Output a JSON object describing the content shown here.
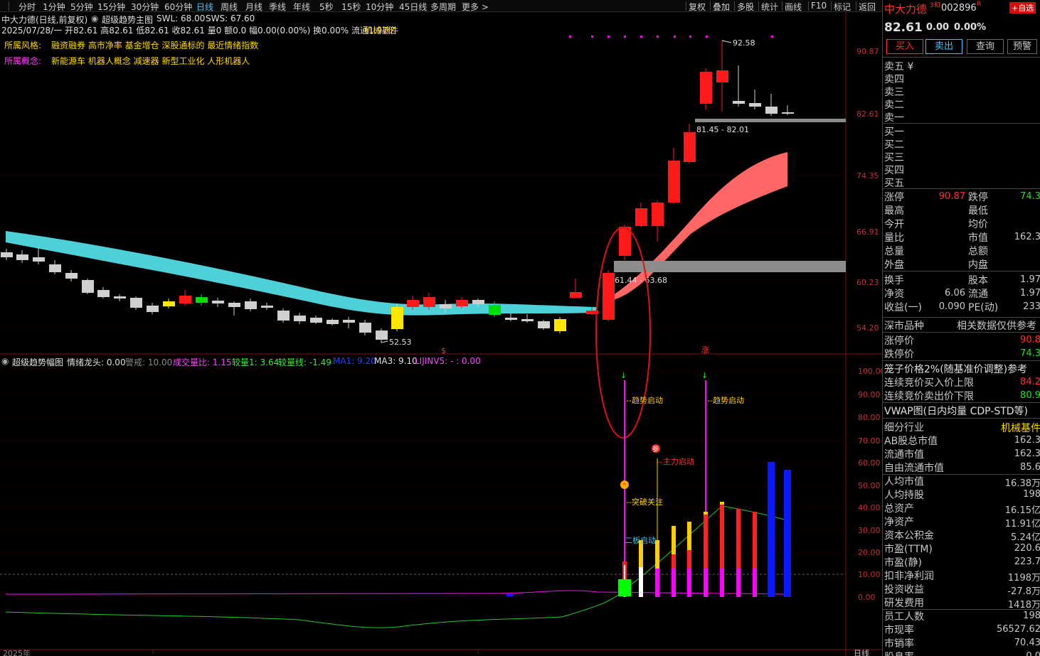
{
  "toolbar": {
    "periods": [
      "分时",
      "1分钟",
      "5分钟",
      "15分钟",
      "30分钟",
      "60分钟",
      "日线",
      "周线",
      "月线",
      "季线",
      "年线",
      "5秒",
      "15秒",
      "10分钟",
      "45日线",
      "多周期",
      "更多 >"
    ],
    "active_period": "日线",
    "right_items": [
      "复权",
      "叠加",
      "多股",
      "统计",
      "画线",
      "F10",
      "标记",
      "返回"
    ]
  },
  "header": {
    "title": "中大力德(日线,前复权)",
    "indicator": "超级趋势主图",
    "swl": "SWL: 68.00",
    "sws": "SWS: 67.60",
    "quote_line": "2025/07/28/一 开82.61 高82.61 低82.61 收82.61 量0 额0.0 幅0.00(0.00%) 换0.00% 流通1.97亿",
    "industry": "机械基件",
    "style_label": "所属风格:",
    "style_value": "融资融券 高市净率 基金增仓 深股通标的 最近情绪指数",
    "concept_label": "所属概念:",
    "concept_value": "新能源车 机器人概念 减速器 新型工业化 人形机器人"
  },
  "main_chart": {
    "price_axis": [
      "90.87",
      "82.61",
      "74.35",
      "66.91",
      "60.23",
      "54.20"
    ],
    "high_label": "92.58",
    "low_label": "52.53",
    "zone_upper": "81.45 - 82.01",
    "zone_lower": "61.44 - 63.68",
    "marker_s": "$",
    "marker_zhang": "涨"
  },
  "sub_chart": {
    "title": "超级趋势幅图",
    "qxlt": "情绪龙头: 0.00",
    "jingjie": "警戒: 10.00",
    "cjlb": "成交量比: 1.15",
    "jl1": "较量1: 3.64",
    "jlx": "较量线: -1.49",
    "ma1": "MA1: 9.20",
    "ma3": "MA3: 9.10",
    "lijinv5": "LIJINV5: - : 0.00",
    "axis": [
      "100.00",
      "90.00",
      "80.00",
      "70.00",
      "60.00",
      "50.00",
      "40.00",
      "30.00",
      "20.00",
      "10.00",
      "0.00"
    ],
    "annotations": {
      "trend1": "--趋势启动",
      "trend2": "--趋势启动",
      "main_force": "--主力启动",
      "breakout": "--突破关注",
      "board2": "二板启动",
      "can_mark": "参"
    }
  },
  "bottom_axis": {
    "left_label": "2025年",
    "right_label": "日线"
  },
  "right_panel": {
    "name": "中大力德",
    "sup": "3和",
    "code": "002896",
    "code_suffix": "R",
    "add_btn": "+自选",
    "price": "82.61",
    "change": "0.00",
    "change_pct": "0.00%",
    "buttons": [
      "买入",
      "卖出",
      "查询",
      "预警"
    ],
    "sell": [
      "卖五 ¥",
      "卖四",
      "卖三",
      "卖二",
      "卖一"
    ],
    "buy": [
      "买一",
      "买二",
      "买三",
      "买四",
      "买五"
    ],
    "stats_left": [
      {
        "k": "涨停",
        "v": "90.87"
      },
      {
        "k": "最高",
        "v": ""
      },
      {
        "k": "今开",
        "v": ""
      },
      {
        "k": "量比",
        "v": ""
      },
      {
        "k": "总量",
        "v": ""
      },
      {
        "k": "外盘",
        "v": ""
      }
    ],
    "stats_right": [
      {
        "k": "跌停",
        "v": "74.3"
      },
      {
        "k": "最低",
        "v": ""
      },
      {
        "k": "均价",
        "v": ""
      },
      {
        "k": "市值",
        "v": "162.3"
      },
      {
        "k": "总额",
        "v": ""
      },
      {
        "k": "内盘",
        "v": ""
      }
    ],
    "fin_left": [
      {
        "k": "换手",
        "v": ""
      },
      {
        "k": "净资",
        "v": "6.06"
      },
      {
        "k": "收益(一)",
        "v": "0.090"
      }
    ],
    "fin_right": [
      {
        "k": "股本",
        "v": "1.97"
      },
      {
        "k": "流通",
        "v": "1.97"
      },
      {
        "k": "PE(动)",
        "v": "233"
      }
    ],
    "market_label": "深市品种",
    "market_note": "相关数据仅供参考",
    "limit_up_label": "涨停价",
    "limit_up_val": "90.8",
    "limit_down_label": "跌停价",
    "limit_down_val": "74.3",
    "cage_label": "笼子价格2%(随基准价调整)参考",
    "bid_limit_label": "连续竞价买入价上限",
    "bid_limit_val": "84.2",
    "ask_limit_label": "连续竞价卖出价下限",
    "ask_limit_val": "80.9",
    "vwap_label": "VWAP图(日内均量 CDP-STD等)",
    "industry_label": "细分行业",
    "industry_val": "机械基件",
    "details": [
      {
        "k": "AB股总市值",
        "v": "162.3"
      },
      {
        "k": "流通市值",
        "v": "162.3"
      },
      {
        "k": "自由流通市值",
        "v": "85.6"
      },
      {
        "k": "人均市值",
        "v": "16.38万"
      },
      {
        "k": "人均持股",
        "v": "198"
      },
      {
        "k": "总资产",
        "v": "16.15亿"
      },
      {
        "k": "净资产",
        "v": "11.91亿"
      },
      {
        "k": "资本公积金",
        "v": "5.24亿"
      },
      {
        "k": "市盈(TTM)",
        "v": "220.6"
      },
      {
        "k": "市盈(静)",
        "v": "223.7"
      },
      {
        "k": "扣非净利润",
        "v": "1198万"
      },
      {
        "k": "投资收益",
        "v": "-27.8万"
      },
      {
        "k": "研发费用",
        "v": "1418万"
      },
      {
        "k": "员工人数",
        "v": "198"
      },
      {
        "k": "市现率",
        "v": "56527.62"
      },
      {
        "k": "市销率",
        "v": "70.43"
      },
      {
        "k": "股息率",
        "v": "0.0"
      }
    ]
  },
  "colors": {
    "up": "#ff1a1a",
    "down": "#c8c8c8",
    "ribbon": "#4dd0d8",
    "pink_ribbon": "#ff6666",
    "magenta": "#ff00ff",
    "yellow": "#ffd700",
    "blue": "#0a1aff"
  }
}
